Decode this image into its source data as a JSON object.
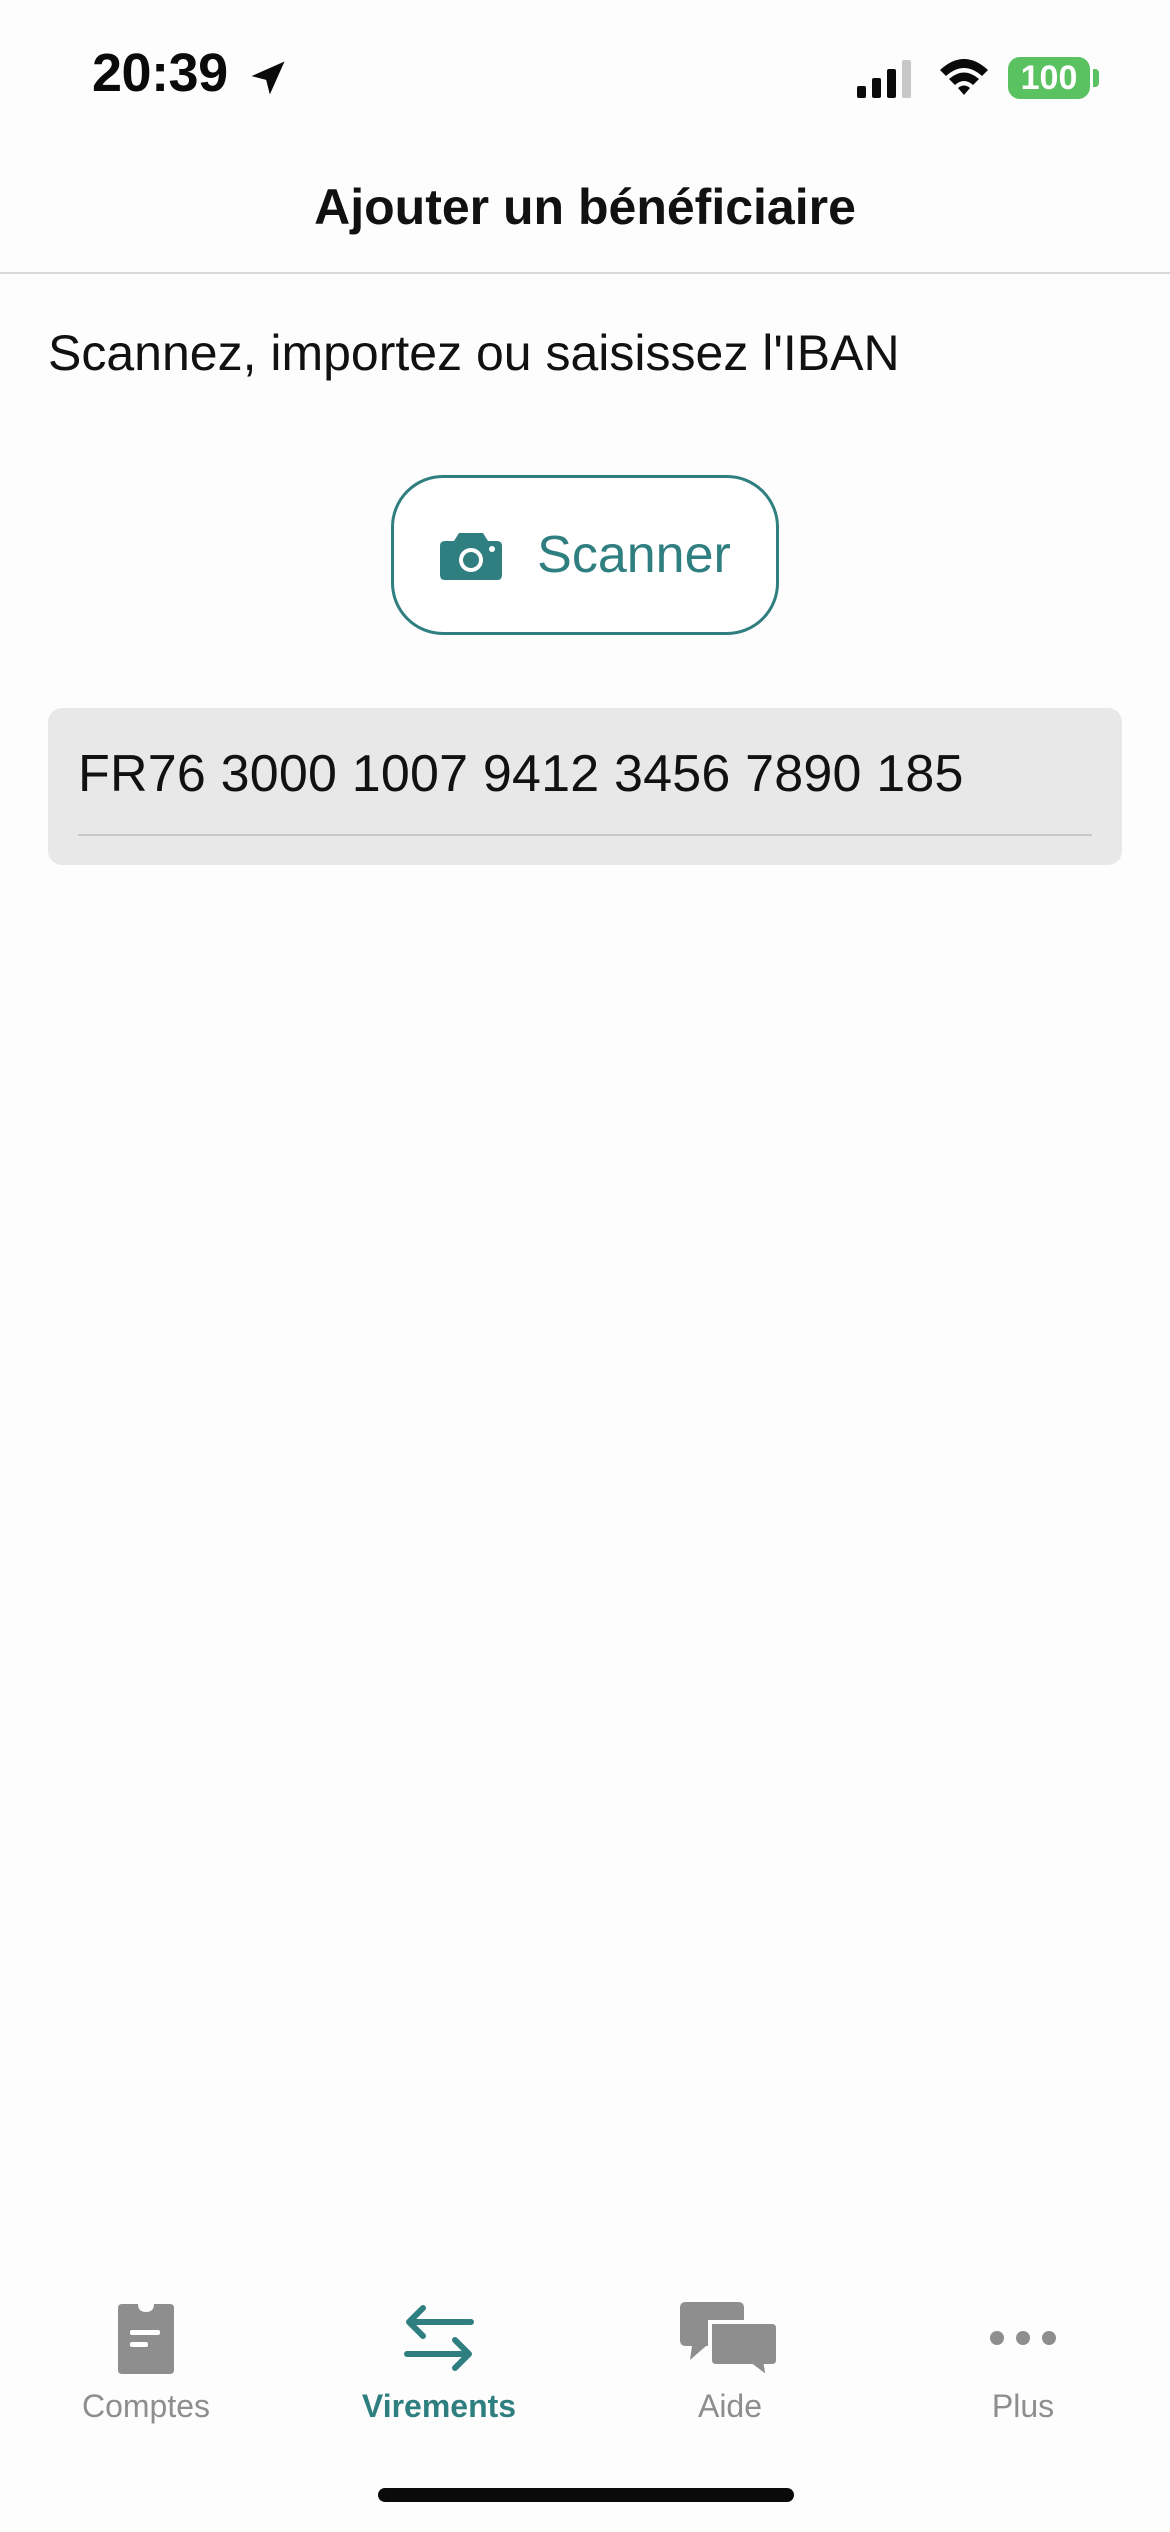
{
  "status_bar": {
    "time": "20:39",
    "battery": "100",
    "icons": [
      "location-arrow-icon",
      "cellular-signal-icon",
      "wifi-icon",
      "battery-icon"
    ]
  },
  "header": {
    "title": "Ajouter un bénéficiaire"
  },
  "main": {
    "instruction": "Scannez, importez ou saisissez l'IBAN",
    "scan_button": {
      "label": "Scanner",
      "icon": "camera-icon"
    },
    "iban_field": {
      "value": "FR76 3000 1007 9412 3456 7890 185"
    }
  },
  "tab_bar": {
    "tabs": [
      {
        "label": "Comptes",
        "icon": "accounts-card-icon",
        "active": false
      },
      {
        "label": "Virements",
        "icon": "transfer-arrows-icon",
        "active": true
      },
      {
        "label": "Aide",
        "icon": "chat-bubbles-icon",
        "active": false
      },
      {
        "label": "Plus",
        "icon": "more-dots-icon",
        "active": false
      }
    ]
  },
  "colors": {
    "accent": "#2f7f80",
    "inactive_tab": "#8e8e8e",
    "battery": "#5ac260",
    "field_background": "#e8e8e8"
  }
}
